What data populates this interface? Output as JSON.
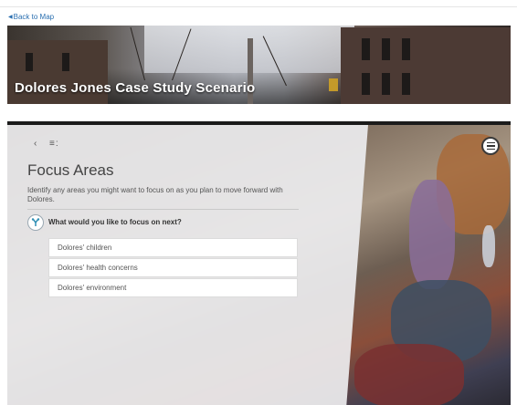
{
  "nav": {
    "back_label": "Back to Map"
  },
  "banner": {
    "title": "Dolores Jones Case Study Scenario"
  },
  "panel": {
    "heading": "Focus Areas",
    "description": "Identify any areas you might want to focus on as you plan to move forward with Dolores.",
    "question": "What would you like to focus on next?",
    "options": [
      "Dolores' children",
      "Dolores' health concerns",
      "Dolores' environment"
    ]
  },
  "icons": {
    "back": "triangle-left-icon",
    "prev": "chevron-left-icon",
    "menu": "list-menu-icon",
    "question": "branch-icon",
    "scene_menu": "hamburger-icon"
  },
  "colors": {
    "link": "#2a6fb0",
    "banner_text": "#ffffff"
  }
}
